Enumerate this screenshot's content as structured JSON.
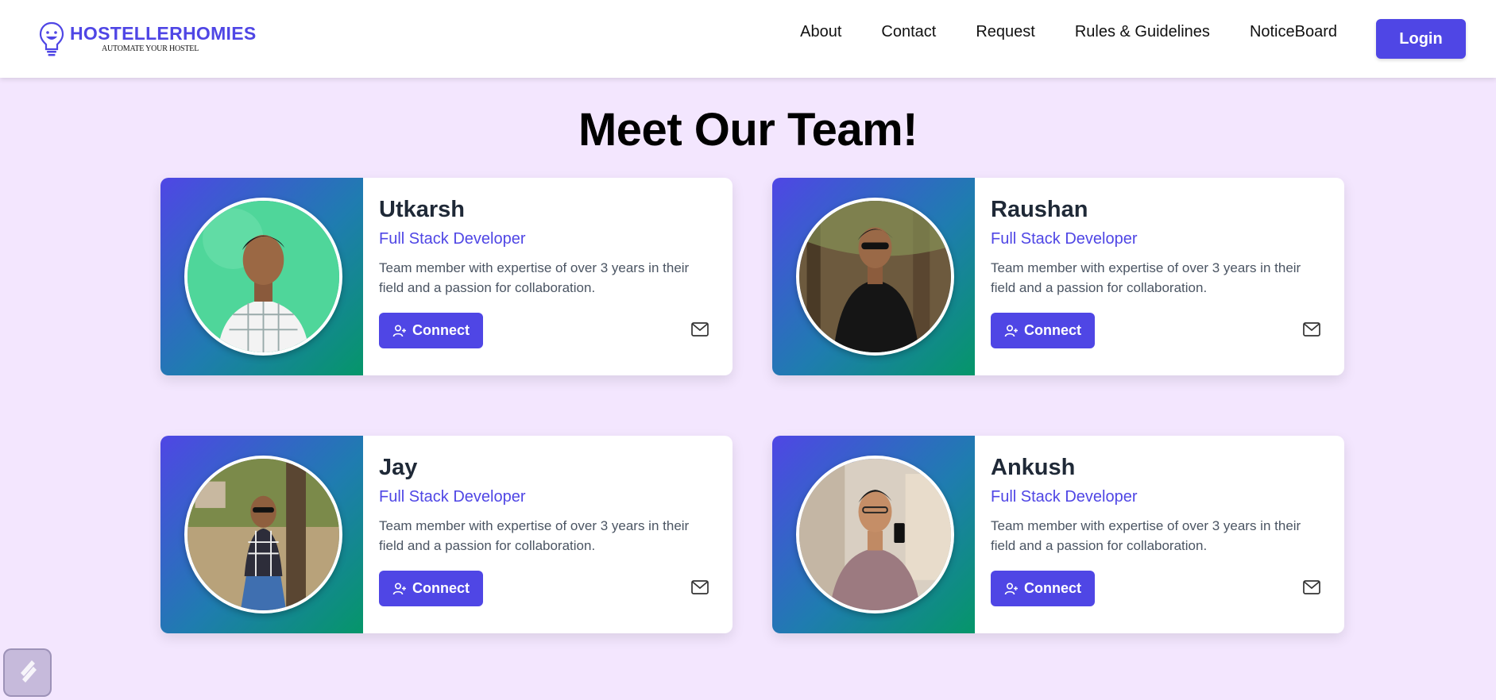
{
  "header": {
    "logo_title": "HOSTELLERHOMIES",
    "logo_tagline": "AUTOMATE YOUR HOSTEL",
    "nav": [
      "About",
      "Contact",
      "Request",
      "Rules & Guidelines",
      "NoticeBoard"
    ],
    "login_label": "Login"
  },
  "page_title": "Meet Our Team!",
  "team": [
    {
      "name": "Utkarsh",
      "role": "Full Stack Developer",
      "description": "Team member with expertise of over 3 years in their field and a passion for collaboration.",
      "connect_label": "Connect"
    },
    {
      "name": "Raushan",
      "role": "Full Stack Developer",
      "description": "Team member with expertise of over 3 years in their field and a passion for collaboration.",
      "connect_label": "Connect"
    },
    {
      "name": "Jay",
      "role": "Full Stack Developer",
      "description": "Team member with expertise of over 3 years in their field and a passion for collaboration.",
      "connect_label": "Connect"
    },
    {
      "name": "Ankush",
      "role": "Full Stack Developer",
      "description": "Team member with expertise of over 3 years in their field and a passion for collaboration.",
      "connect_label": "Connect"
    }
  ],
  "colors": {
    "accent": "#4f46e5",
    "page_background": "#f3e6fe",
    "gradient_start": "#4f46e5",
    "gradient_end": "#059669"
  },
  "icons": {
    "logo": "lightbulb-face-icon",
    "connect": "user-plus-icon",
    "email": "mail-icon",
    "widget": "bolt-widget-icon"
  }
}
